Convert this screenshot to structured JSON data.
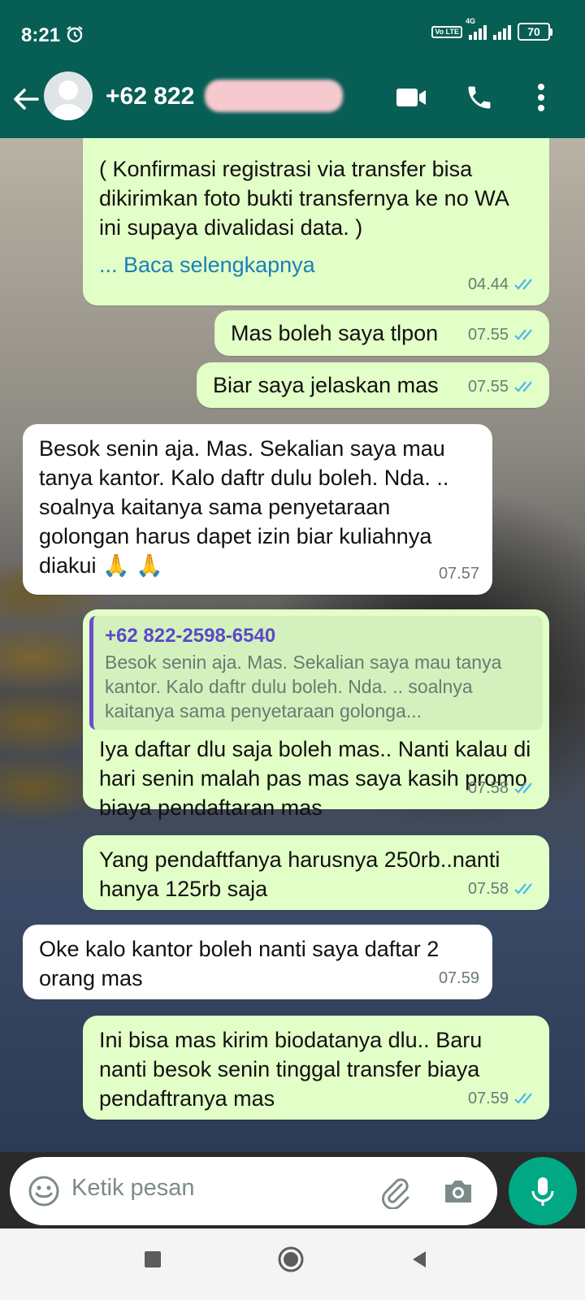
{
  "status_bar": {
    "time": "8:21",
    "volte": "Vo LTE",
    "network": "4G",
    "battery": "70",
    "icons": [
      "alarm-icon",
      "signal-icon",
      "battery-icon"
    ]
  },
  "header": {
    "contact_visible": "+62 822",
    "icons": [
      "back-arrow-icon",
      "avatar-icon",
      "video-call-icon",
      "voice-call-icon",
      "more-options-icon"
    ]
  },
  "messages": [
    {
      "direction": "out",
      "text": "( Konfirmasi registrasi via transfer bisa dikirimkan foto bukti transfernya ke no WA ini supaya divalidasi data. )",
      "read_more": "... Baca selengkapnya",
      "time": "04.44"
    },
    {
      "direction": "out",
      "text": "Mas boleh saya tlpon",
      "time": "07.55"
    },
    {
      "direction": "out",
      "text": "Biar saya jelaskan mas",
      "time": "07.55"
    },
    {
      "direction": "in",
      "text": "Besok senin aja. Mas. Sekalian saya mau tanya kantor. Kalo daftr dulu boleh. Nda. .. soalnya kaitanya sama penyetaraan golongan  harus dapet izin biar kuliahnya diakui 🙏 🙏",
      "time": "07.57"
    },
    {
      "direction": "out",
      "quote": {
        "name": "+62 822-2598-6540",
        "text": "Besok senin aja. Mas. Sekalian saya mau tanya kantor. Kalo daftr dulu boleh. Nda. .. soalnya kaitanya sama penyetaraan golonga..."
      },
      "text": "Iya daftar dlu saja boleh mas.. Nanti kalau di hari senin malah pas mas saya kasih promo biaya pendaftaran mas",
      "time": "07.58"
    },
    {
      "direction": "out",
      "text": "Yang pendaftfanya harusnya 250rb..nanti hanya 125rb saja",
      "time": "07.58"
    },
    {
      "direction": "in",
      "text": "Oke kalo kantor boleh nanti saya daftar 2 orang mas",
      "time": "07.59"
    },
    {
      "direction": "out",
      "text": "Ini bisa mas kirim biodatanya dlu.. Baru nanti besok senin tinggal transfer biaya pendaftranya mas",
      "time": "07.59"
    }
  ],
  "input": {
    "placeholder": "Ketik pesan",
    "icons": [
      "emoji-icon",
      "attach-icon",
      "camera-icon",
      "mic-icon"
    ]
  },
  "colors": {
    "header": "#075e54",
    "outgoing_bubble": "#e2ffc7",
    "incoming_bubble": "#ffffff",
    "read_ticks": "#4fb6ec",
    "fab": "#00a884",
    "link": "#1d7eb8",
    "quote_name": "#5b49c9"
  },
  "nav_bar": {
    "icons": [
      "recents-square-icon",
      "home-circle-icon",
      "back-triangle-icon"
    ]
  }
}
